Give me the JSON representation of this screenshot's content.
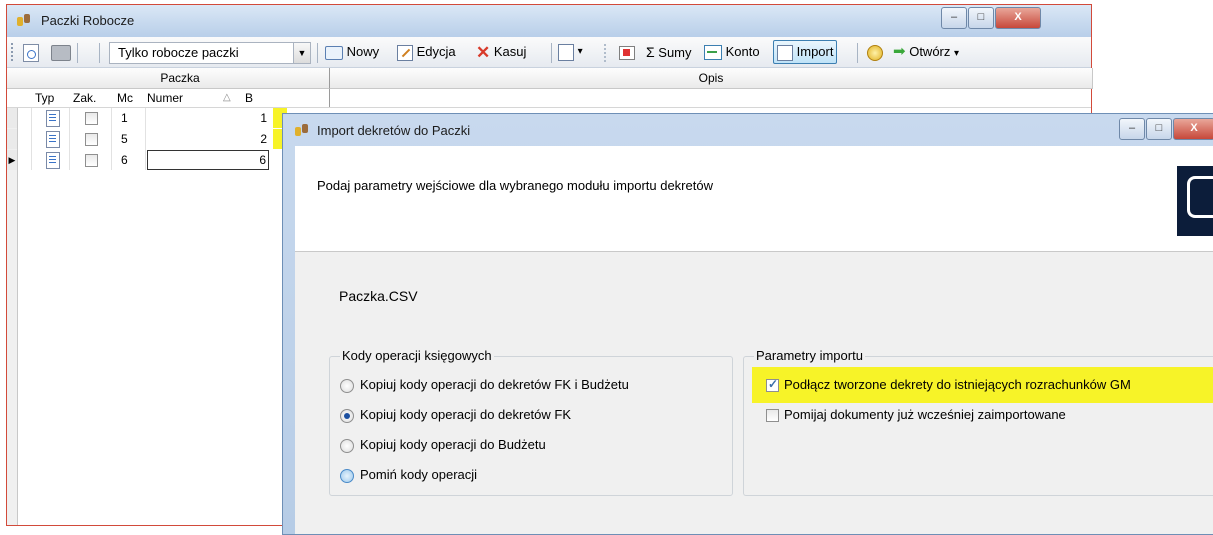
{
  "main_window": {
    "title": "Paczki Robocze",
    "caption_minimize": "–",
    "caption_maximize": "□",
    "caption_close": "X"
  },
  "toolbar": {
    "filter_value": "Tylko robocze paczki",
    "new_label": "Nowy",
    "edit_label": "Edycja",
    "delete_label": "Kasuj",
    "sums_label": "Sumy",
    "account_label": "Konto",
    "import_label": "Import",
    "open_label": "Otwórz"
  },
  "grid": {
    "group_headers": [
      "Paczka",
      "Opis"
    ],
    "columns": [
      "Typ",
      "Zak.",
      "Mc",
      "Numer",
      "B"
    ],
    "rows": [
      {
        "mc": "1",
        "numer": "1"
      },
      {
        "mc": "5",
        "numer": "2"
      },
      {
        "mc": "6",
        "numer": "6"
      }
    ]
  },
  "dialog": {
    "title": "Import dekretów do Paczki",
    "instruction": "Podaj parametry wejściowe dla wybranego modułu importu dekretów",
    "module_name": "Paczka.CSV",
    "group_left": {
      "title": "Kody operacji księgowych",
      "options": [
        "Kopiuj kody operacji do dekretów FK i Budżetu",
        "Kopiuj kody operacji do dekretów FK",
        "Kopiuj kody operacji do Budżetu",
        "Pomiń kody operacji"
      ],
      "selected_index": 1
    },
    "group_right": {
      "title": "Parametry importu",
      "options": [
        "Podłącz tworzone dekrety do istniejących rozrachunków GM",
        "Pomijaj dokumenty już wcześniej zaimportowane"
      ],
      "checked": [
        true,
        false
      ]
    }
  },
  "colors": {
    "highlight": "#f7f328",
    "title_bar": "#c5d8ee",
    "accent": "#1b4fa0"
  }
}
